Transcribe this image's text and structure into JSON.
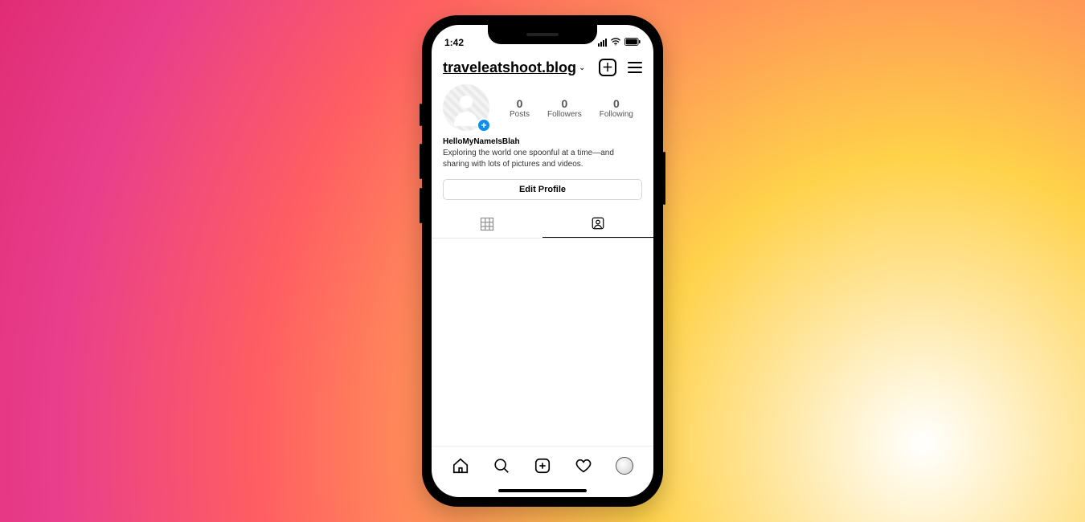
{
  "status": {
    "time": "1:42"
  },
  "header": {
    "username": "traveleatshoot.blog"
  },
  "stats": {
    "posts": {
      "count": "0",
      "label": "Posts"
    },
    "followers": {
      "count": "0",
      "label": "Followers"
    },
    "following": {
      "count": "0",
      "label": "Following"
    }
  },
  "profile": {
    "display_name": "HelloMyNameIsBlah",
    "bio": "Exploring the world one spoonful at a time—and sharing with lots of pictures and videos."
  },
  "buttons": {
    "edit_profile": "Edit Profile"
  }
}
